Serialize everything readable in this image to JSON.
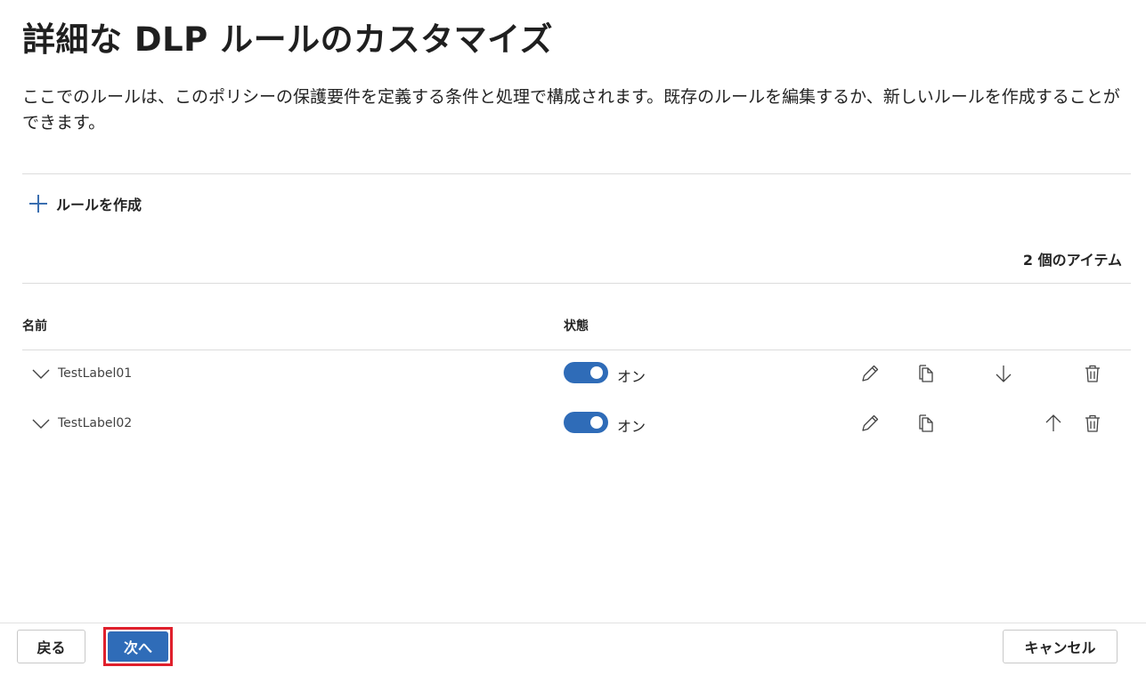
{
  "page": {
    "title": "詳細な DLP ルールのカスタマイズ",
    "description": "ここでのルールは、このポリシーの保護要件を定義する条件と処理で構成されます。既存のルールを編集するか、新しいルールを作成することができます。"
  },
  "toolbar": {
    "create_rule_label": "ルールを作成",
    "item_count": "2 個のアイテム"
  },
  "table": {
    "columns": [
      "名前",
      "状態"
    ],
    "rows": [
      {
        "name": "TestLabel01",
        "status": "オン",
        "enabled": true,
        "actions": [
          "edit-icon",
          "copy-icon",
          "move-down-icon",
          "delete-icon"
        ]
      },
      {
        "name": "TestLabel02",
        "status": "オン",
        "enabled": true,
        "actions": [
          "edit-icon",
          "copy-icon",
          "move-up-icon",
          "delete-icon"
        ]
      }
    ]
  },
  "footer": {
    "back_label": "戻る",
    "next_label": "次へ",
    "cancel_label": "キャンセル"
  },
  "colors": {
    "accent": "#2f6cb8",
    "highlight_outline": "#e0202c"
  }
}
